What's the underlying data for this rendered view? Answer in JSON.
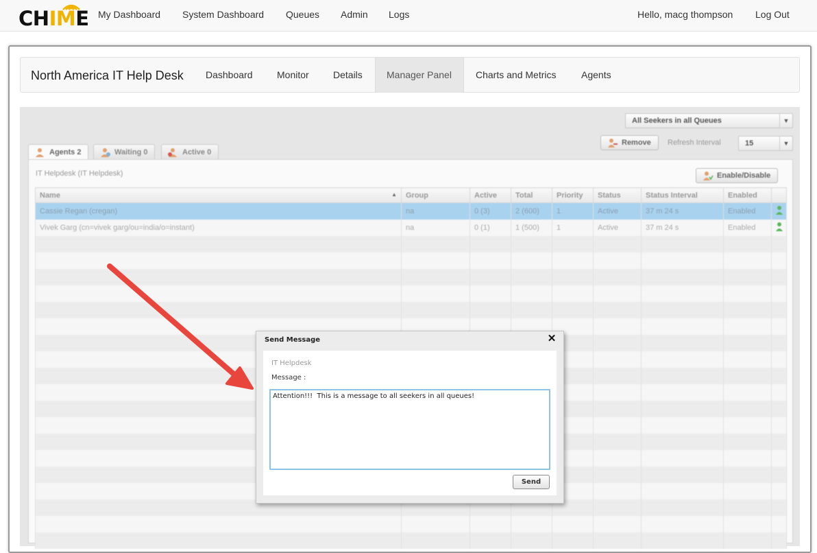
{
  "navbar": {
    "logo_prefix": "CH",
    "logo_highlight": "IM",
    "logo_suffix": "E",
    "links": [
      "My Dashboard",
      "System Dashboard",
      "Queues",
      "Admin",
      "Logs"
    ],
    "greeting": "Hello, macg thompson",
    "logout": "Log Out"
  },
  "subnav": {
    "brand": "North America IT Help Desk",
    "tabs": [
      "Dashboard",
      "Monitor",
      "Details",
      "Manager Panel",
      "Charts and Metrics",
      "Agents"
    ],
    "active_tab": "Manager Panel"
  },
  "panel": {
    "seeker_filter": "All Seekers in all Queues",
    "remove_button": "Remove",
    "refresh_label": "Refresh Interval",
    "refresh_value": "15",
    "enable_disable_button": "Enable/Disable",
    "queue_tabs": [
      {
        "label": "Agents 2"
      },
      {
        "label": "Waiting 0"
      },
      {
        "label": "Active 0"
      }
    ],
    "grid_caption": "IT Helpdesk (IT Helpdesk)",
    "columns": [
      "Name",
      "Group",
      "Active",
      "Total",
      "Priority",
      "Status",
      "Status Interval",
      "Enabled",
      ""
    ],
    "rows": [
      {
        "name": "Cassie Regan (cregan)",
        "group": "na",
        "active": "0 (3)",
        "total": "2 (600)",
        "priority": "1",
        "status": "Active",
        "interval": "37 m 24 s",
        "enabled": "Enabled",
        "selected": true
      },
      {
        "name": "Vivek Garg (cn=vivek garg/ou=india/o=instant)",
        "group": "na",
        "active": "0 (1)",
        "total": "1 (500)",
        "priority": "1",
        "status": "Active",
        "interval": "37 m 24 s",
        "enabled": "Enabled",
        "selected": false
      }
    ]
  },
  "dialog": {
    "title": "Send Message",
    "queue": "IT Helpdesk",
    "message_label": "Message :",
    "message_value": "Attention!!!  This is a message to all seekers in all queues!",
    "send_button": "Send"
  },
  "colors": {
    "logo_accent": "#f0b400",
    "selected_row": "#a9d2ee",
    "textarea_focus": "#8ec3e8",
    "arrow": "#e8453c",
    "agent_icon": "#5cb85c"
  },
  "icons": {
    "logo_waves": "wifi-waves-icon",
    "close": "close-icon",
    "agent_status": "person-icon",
    "arrow": "red-arrow-annotation"
  }
}
